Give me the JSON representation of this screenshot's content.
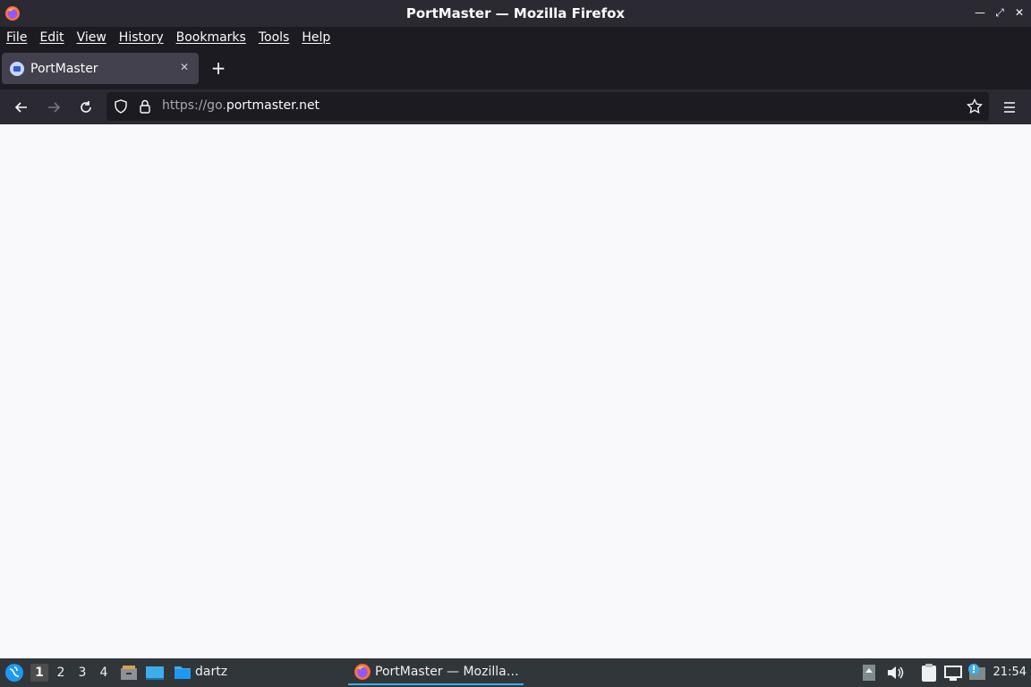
{
  "window": {
    "title": "PortMaster — Mozilla Firefox"
  },
  "menu": {
    "items": [
      "File",
      "Edit",
      "View",
      "History",
      "Bookmarks",
      "Tools",
      "Help"
    ]
  },
  "tabs": [
    {
      "label": "PortMaster"
    }
  ],
  "urlbar": {
    "url_prefix": "https://go.",
    "url_domain": "portmaster.net"
  },
  "taskbar": {
    "workspaces": [
      "1",
      "2",
      "3",
      "4"
    ],
    "folder_label": "dartz",
    "active_task_label": "PortMaster — Mozilla…",
    "clock": "21:54"
  },
  "colors": {
    "accent": "#3daee9",
    "titlebar": "#2b2a33",
    "menubar": "#1c1b22",
    "taskbar": "#31363b"
  }
}
